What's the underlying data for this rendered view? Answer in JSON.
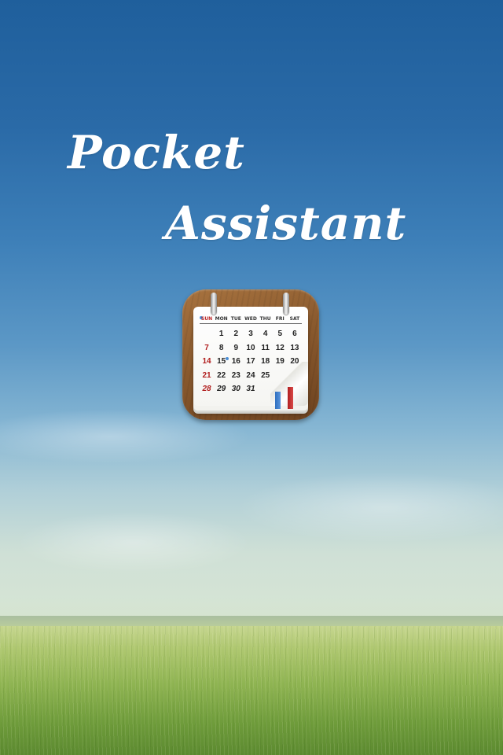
{
  "splash": {
    "title_line1": "Pocket",
    "title_line2": "Assistant"
  },
  "app_icon": {
    "name": "calendar-icon",
    "weekdays": [
      "SUN",
      "MON",
      "TUE",
      "WED",
      "THU",
      "FRI",
      "SAT"
    ],
    "weeks": [
      [
        "",
        "1",
        "2",
        "3",
        "4",
        "5",
        "6"
      ],
      [
        "7",
        "8",
        "9",
        "10",
        "11",
        "12",
        "13"
      ],
      [
        "14",
        "15",
        "16",
        "17",
        "18",
        "19",
        "20"
      ],
      [
        "21",
        "22",
        "23",
        "24",
        "25",
        "",
        ""
      ],
      [
        "28",
        "29",
        "30",
        "31",
        "",
        "",
        ""
      ]
    ]
  },
  "colors": {
    "sky_top": "#1f5f9c",
    "field": "#8fb452",
    "title_text": "#ffffff",
    "sunday_red": "#b01c1c"
  }
}
